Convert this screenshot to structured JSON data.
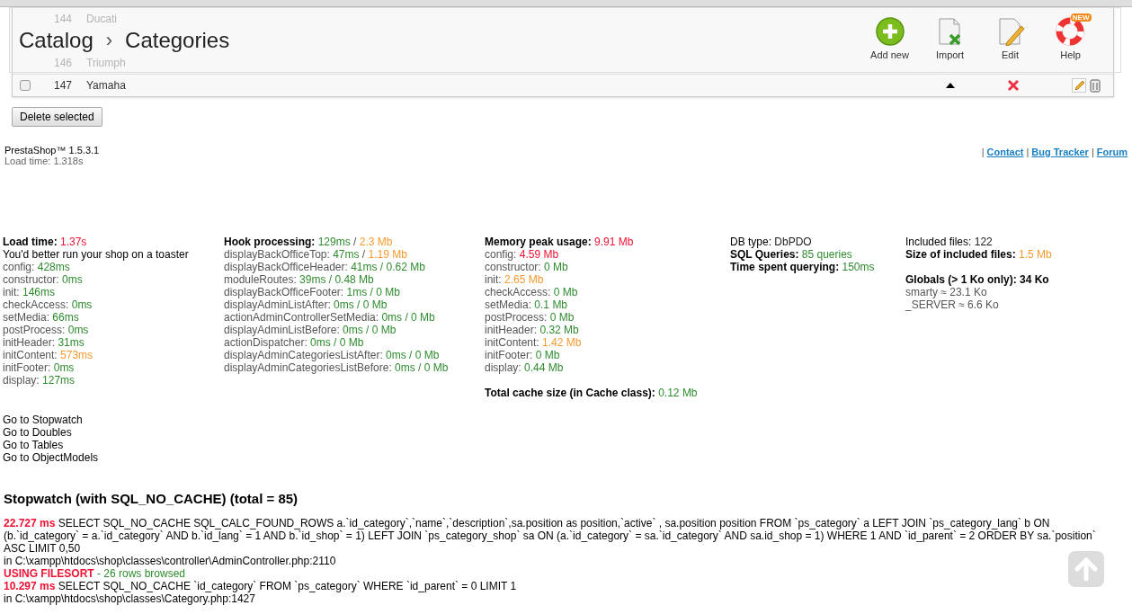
{
  "header": {
    "breadcrumb": [
      "Catalog",
      "Categories"
    ],
    "separator": "›",
    "toolbar": [
      {
        "kind": "add",
        "label": "Add new"
      },
      {
        "kind": "import",
        "label": "Import"
      },
      {
        "kind": "edit",
        "label": "Edit"
      },
      {
        "kind": "help",
        "label": "Help",
        "badge": "NEW"
      }
    ]
  },
  "rows_behind_header": [
    {
      "id": "144",
      "name": "Ducati"
    },
    {
      "id": "146",
      "name": "Triumph"
    }
  ],
  "rows": [
    {
      "id": "147",
      "name": "Yamaha",
      "active": false,
      "checked": false
    }
  ],
  "delete_button": "Delete selected",
  "footer": {
    "version": "PrestaShop™ 1.5.3.1",
    "load_time": "Load time: 1.318s",
    "links": [
      "Contact",
      "Bug Tracker",
      "Forum"
    ],
    "separator": "|"
  },
  "profile_columns": [
    [
      {
        "kind": "heading",
        "label": "Load time: ",
        "segments": [
          {
            "text": "1.37s",
            "color": "#ee1133"
          }
        ]
      },
      {
        "kind": "note",
        "label": "You'd better run your shop on a toaster"
      },
      {
        "kind": "item",
        "label": "config: ",
        "segments": [
          {
            "text": "428ms",
            "color": "#2e8b2e"
          }
        ]
      },
      {
        "kind": "item",
        "label": "constructor: ",
        "segments": [
          {
            "text": "0ms",
            "color": "#2e8b2e"
          }
        ]
      },
      {
        "kind": "item",
        "label": "init: ",
        "segments": [
          {
            "text": "146ms",
            "color": "#2e8b2e"
          }
        ]
      },
      {
        "kind": "item",
        "label": "checkAccess: ",
        "segments": [
          {
            "text": "0ms",
            "color": "#2e8b2e"
          }
        ]
      },
      {
        "kind": "item",
        "label": "setMedia: ",
        "segments": [
          {
            "text": "66ms",
            "color": "#2e8b2e"
          }
        ]
      },
      {
        "kind": "item",
        "label": "postProcess: ",
        "segments": [
          {
            "text": "0ms",
            "color": "#2e8b2e"
          }
        ]
      },
      {
        "kind": "item",
        "label": "initHeader: ",
        "segments": [
          {
            "text": "31ms",
            "color": "#2e8b2e"
          }
        ]
      },
      {
        "kind": "item",
        "label": "initContent: ",
        "segments": [
          {
            "text": "573ms",
            "color": "#f79a2e"
          }
        ]
      },
      {
        "kind": "item",
        "label": "initFooter: ",
        "segments": [
          {
            "text": "0ms",
            "color": "#2e8b2e"
          }
        ]
      },
      {
        "kind": "item",
        "label": "display: ",
        "segments": [
          {
            "text": "127ms",
            "color": "#2e8b2e"
          }
        ]
      }
    ],
    [
      {
        "kind": "heading",
        "label": "Hook processing: ",
        "segments": [
          {
            "text": "129ms",
            "color": "#2e8b2e"
          },
          {
            "text": " / "
          },
          {
            "text": "2.3 Mb",
            "color": "#f79a2e"
          }
        ]
      },
      {
        "kind": "item",
        "label": "displayBackOfficeTop: ",
        "segments": [
          {
            "text": "47ms",
            "color": "#2e8b2e"
          },
          {
            "text": " / "
          },
          {
            "text": "1.19 Mb",
            "color": "#f79a2e"
          }
        ]
      },
      {
        "kind": "item",
        "label": "displayBackOfficeHeader: ",
        "segments": [
          {
            "text": "41ms / 0.62 Mb",
            "color": "#2e8b2e"
          }
        ]
      },
      {
        "kind": "item",
        "label": "moduleRoutes: ",
        "segments": [
          {
            "text": "39ms / 0.48 Mb",
            "color": "#2e8b2e"
          }
        ]
      },
      {
        "kind": "item",
        "label": "displayBackOfficeFooter: ",
        "segments": [
          {
            "text": "1ms / 0 Mb",
            "color": "#2e8b2e"
          }
        ]
      },
      {
        "kind": "item",
        "label": "displayAdminListAfter: ",
        "segments": [
          {
            "text": "0ms / 0 Mb",
            "color": "#2e8b2e"
          }
        ]
      },
      {
        "kind": "item",
        "label": "actionAdminControllerSetMedia: ",
        "segments": [
          {
            "text": "0ms / 0 Mb",
            "color": "#2e8b2e"
          }
        ]
      },
      {
        "kind": "item",
        "label": "displayAdminListBefore: ",
        "segments": [
          {
            "text": "0ms / 0 Mb",
            "color": "#2e8b2e"
          }
        ]
      },
      {
        "kind": "item",
        "label": "actionDispatcher: ",
        "segments": [
          {
            "text": "0ms / 0 Mb",
            "color": "#2e8b2e"
          }
        ]
      },
      {
        "kind": "item",
        "label": "displayAdminCategoriesListAfter: ",
        "segments": [
          {
            "text": "0ms / 0 Mb",
            "color": "#2e8b2e"
          }
        ]
      },
      {
        "kind": "item",
        "label": "displayAdminCategoriesListBefore: ",
        "segments": [
          {
            "text": "0ms / 0 Mb",
            "color": "#2e8b2e"
          }
        ]
      }
    ],
    [
      {
        "kind": "heading",
        "label": "Memory peak usage: ",
        "segments": [
          {
            "text": "9.91 Mb",
            "color": "#ee1133"
          }
        ]
      },
      {
        "kind": "item",
        "label": "config: ",
        "segments": [
          {
            "text": "4.59 Mb",
            "color": "#ee1133"
          }
        ]
      },
      {
        "kind": "item",
        "label": "constructor: ",
        "segments": [
          {
            "text": "0 Mb",
            "color": "#2e8b2e"
          }
        ]
      },
      {
        "kind": "item",
        "label": "init: ",
        "segments": [
          {
            "text": "2.65 Mb",
            "color": "#f79a2e"
          }
        ]
      },
      {
        "kind": "item",
        "label": "checkAccess: ",
        "segments": [
          {
            "text": "0 Mb",
            "color": "#2e8b2e"
          }
        ]
      },
      {
        "kind": "item",
        "label": "setMedia: ",
        "segments": [
          {
            "text": "0.1 Mb",
            "color": "#2e8b2e"
          }
        ]
      },
      {
        "kind": "item",
        "label": "postProcess: ",
        "segments": [
          {
            "text": "0 Mb",
            "color": "#2e8b2e"
          }
        ]
      },
      {
        "kind": "item",
        "label": "initHeader: ",
        "segments": [
          {
            "text": "0.32 Mb",
            "color": "#2e8b2e"
          }
        ]
      },
      {
        "kind": "item",
        "label": "initContent: ",
        "segments": [
          {
            "text": "1.42 Mb",
            "color": "#f79a2e"
          }
        ]
      },
      {
        "kind": "item",
        "label": "initFooter: ",
        "segments": [
          {
            "text": "0 Mb",
            "color": "#2e8b2e"
          }
        ]
      },
      {
        "kind": "item",
        "label": "display: ",
        "segments": [
          {
            "text": "0.44 Mb",
            "color": "#2e8b2e"
          }
        ]
      },
      {
        "kind": "gap"
      },
      {
        "kind": "heading",
        "label": "Total cache size (in Cache class): ",
        "segments": [
          {
            "text": "0.12 Mb",
            "color": "#2e8b2e"
          }
        ]
      }
    ],
    [
      {
        "kind": "plain",
        "label": "DB type: ",
        "segments": [
          {
            "text": "DbPDO",
            "color": "#222222"
          }
        ]
      },
      {
        "kind": "heading",
        "label": "SQL Queries: ",
        "segments": [
          {
            "text": "85 queries",
            "color": "#2e8b2e"
          }
        ]
      },
      {
        "kind": "heading",
        "label": "Time spent querying: ",
        "segments": [
          {
            "text": "150ms",
            "color": "#2e8b2e"
          }
        ]
      }
    ],
    [
      {
        "kind": "plain",
        "label": "Included files: ",
        "segments": [
          {
            "text": "122",
            "color": "#222222"
          }
        ]
      },
      {
        "kind": "heading",
        "label": "Size of included files: ",
        "segments": [
          {
            "text": "1.5 Mb",
            "color": "#f79a2e"
          }
        ]
      },
      {
        "kind": "gap"
      },
      {
        "kind": "heading",
        "label": "Globals (> 1 Ko only): 34 Ko"
      },
      {
        "kind": "item",
        "label": "smarty ≈ 23.1 Ko"
      },
      {
        "kind": "item",
        "label": "_SERVER ≈ 6.6 Ko"
      }
    ]
  ],
  "goto_links": [
    "Go to Stopwatch",
    "Go to Doubles",
    "Go to Tables",
    "Go to ObjectModels"
  ],
  "stopwatch": {
    "title": "Stopwatch (with SQL_NO_CACHE) (total = 85)",
    "queries": [
      {
        "time": "22.727 ms",
        "sql": "SELECT SQL_NO_CACHE SQL_CALC_FOUND_ROWS a.`id_category`,`name`,`description`,sa.position as position,`active` , sa.position position FROM `ps_category` a LEFT JOIN `ps_category_lang` b ON (b.`id_category` = a.`id_category` AND b.`id_lang` = 1 AND b.`id_shop` = 1) LEFT JOIN `ps_category_shop` sa ON (a.`id_category` = sa.`id_category` AND sa.id_shop = 1) WHERE 1 AND `id_parent` = 2 ORDER BY sa.`position` ASC LIMIT 0,50",
        "location": "in C:\\xampp\\htdocs\\shop\\classes\\controller\\AdminController.php:2110",
        "warning": "USING FILESORT",
        "warning_note": " - 26 rows browsed"
      },
      {
        "time": "10.297 ms",
        "sql": "SELECT SQL_NO_CACHE `id_category` FROM `ps_category` WHERE `id_parent` = 0 LIMIT 1",
        "location": "in C:\\xampp\\htdocs\\shop\\classes\\Category.php:1427"
      }
    ]
  }
}
